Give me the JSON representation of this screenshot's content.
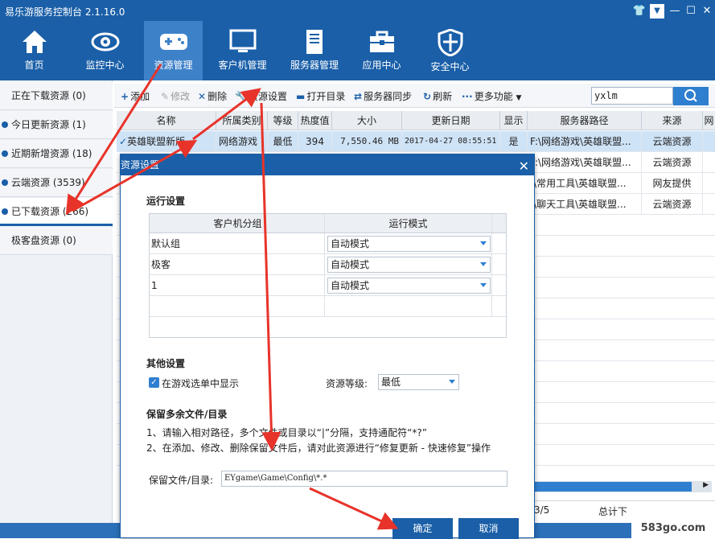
{
  "app": {
    "title": "易乐游服务控制台 2.1.16.0"
  },
  "nav": [
    {
      "label": "首页",
      "icon": "home-icon"
    },
    {
      "label": "监控中心",
      "icon": "eye-icon"
    },
    {
      "label": "资源管理",
      "icon": "gamepad-icon"
    },
    {
      "label": "客户机管理",
      "icon": "monitor-icon"
    },
    {
      "label": "服务器管理",
      "icon": "server-icon"
    },
    {
      "label": "应用中心",
      "icon": "toolbox-icon"
    },
    {
      "label": "安全中心",
      "icon": "shield-icon"
    }
  ],
  "sidebar": [
    {
      "label": "正在下载资源 (0)"
    },
    {
      "label": "今日更新资源 (1)"
    },
    {
      "label": "近期新增资源 (18)"
    },
    {
      "label": "云端资源 (3539)"
    },
    {
      "label": "已下载资源 (266)"
    },
    {
      "label": "极客盘资源 (0)"
    }
  ],
  "toolbar": {
    "add": "添加",
    "edit": "修改",
    "delete": "删除",
    "settings": "资源设置",
    "open_dir": "打开目录",
    "sync": "服务器同步",
    "refresh": "刷新",
    "more": "更多功能"
  },
  "search": {
    "value": "yxlm"
  },
  "grid": {
    "headers": [
      "名称",
      "所属类别",
      "等级",
      "热度值",
      "大小",
      "更新日期",
      "显示",
      "服务器路径",
      "来源",
      "网"
    ],
    "rows": [
      [
        "英雄联盟新版",
        "网络游戏",
        "最低",
        "394",
        "7,550.46 MB",
        "2017-04-27 08:55:51",
        "是",
        "F:\\网络游戏\\英雄联盟...",
        "云端资源"
      ],
      [
        "",
        "",
        "",
        "",
        "",
        "",
        "",
        "F:\\网络游戏\\英雄联盟...",
        "云端资源"
      ],
      [
        "",
        "",
        "",
        "",
        "",
        "",
        "",
        ":\\常用工具\\英雄联盟...",
        "网友提供"
      ],
      [
        "",
        "",
        "",
        "",
        "",
        "",
        "",
        ":\\聊天工具\\英雄联盟...",
        "云端资源"
      ]
    ]
  },
  "status": {
    "pager": "3/5",
    "total": "总计下"
  },
  "watermark": "583go.com",
  "dialog": {
    "title": "资源设置",
    "run_settings": "运行设置",
    "table_headers": [
      "客户机分组",
      "运行模式"
    ],
    "table_rows": [
      {
        "group": "默认组",
        "mode": "自动模式"
      },
      {
        "group": "极客",
        "mode": "自动模式"
      },
      {
        "group": "1",
        "mode": "自动模式"
      }
    ],
    "other_settings": "其他设置",
    "show_in_menu": "在游戏选单中显示",
    "level_label": "资源等级:",
    "level_value": "最低",
    "keep_title": "保留多余文件/目录",
    "note1": "1、请输入相对路径，多个文件或目录以“|”分隔，支持通配符“*?”",
    "note2": "2、在添加、修改、删除保留文件后，请对此资源进行“修复更新 - 快速修复”操作",
    "keep_label": "保留文件/目录:",
    "keep_value": "EYgame\\Game\\Config\\*.*",
    "ok": "确定",
    "cancel": "取消"
  }
}
